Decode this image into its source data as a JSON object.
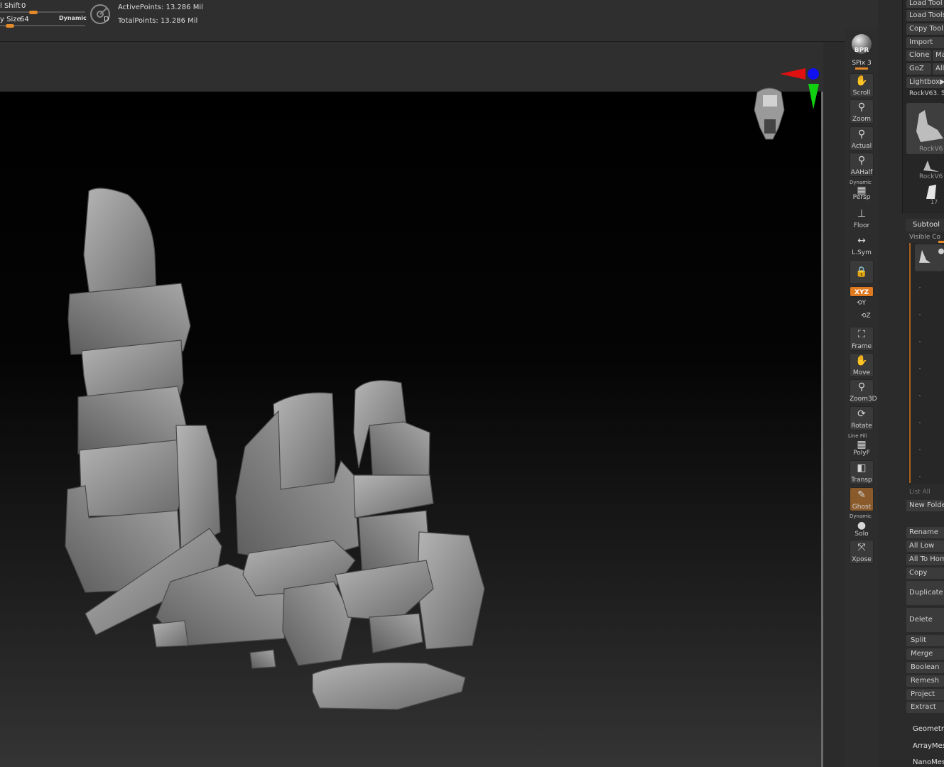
{
  "topbar": {
    "z_shift_label": "l Shift",
    "z_shift_value": "0",
    "z_shift_level": 0.4,
    "draw_size_label": "y Size",
    "draw_size_value": "64",
    "draw_size_level": 0.12,
    "dynamic_label": "Dynamic",
    "dial_label": "D",
    "active_points": "ActivePoints: 13.286 Mil",
    "total_points": "TotalPoints: 13.286 Mil"
  },
  "shelf": {
    "bpr_label": "BPR",
    "spix_label": "SPix 3",
    "items": [
      {
        "label": "Scroll",
        "icon": "hand-scroll-icon"
      },
      {
        "label": "Zoom",
        "icon": "zoom-icon"
      },
      {
        "label": "Actual",
        "icon": "actual-icon"
      },
      {
        "label": "AAHalf",
        "icon": "aahalf-icon"
      },
      {
        "label": "Persp",
        "icon": "perspective-icon",
        "top_note": "Dynamic"
      },
      {
        "label": "Floor",
        "icon": "floor-icon"
      },
      {
        "label": "L.Sym",
        "icon": "local-symmetry-icon"
      },
      {
        "label": "",
        "icon": "lock-icon"
      },
      {
        "label": "XYZ",
        "icon": "xyz-rotation-icon",
        "active": true
      },
      {
        "label": "Y",
        "icon": "y-rotation-icon"
      },
      {
        "label": "Z",
        "icon": "z-rotation-icon"
      },
      {
        "label": "Frame",
        "icon": "frame-icon"
      },
      {
        "label": "Move",
        "icon": "move-icon"
      },
      {
        "label": "Zoom3D",
        "icon": "zoom3d-icon"
      },
      {
        "label": "Rotate",
        "icon": "rotate-icon"
      },
      {
        "label": "PolyF",
        "icon": "polyframe-icon",
        "top_note": "Line Fill"
      },
      {
        "label": "Transp",
        "icon": "transparency-icon"
      },
      {
        "label": "Ghost",
        "icon": "ghost-icon",
        "active": true
      },
      {
        "label": "Solo",
        "icon": "solo-icon",
        "top_note": "Dynamic"
      },
      {
        "label": "Xpose",
        "icon": "xpose-icon"
      }
    ]
  },
  "tool_panel": {
    "buttons_top": [
      "Load Tool",
      "Load Tools",
      "Copy Tool",
      "Import"
    ],
    "clone": "Clone",
    "make": "Ma",
    "goz": "GoZ",
    "all": "All",
    "lightbox": "Lightbox▶",
    "current_tool": "RockV63. 5",
    "thumb_labels": [
      "RockV6",
      "RockV6",
      "17"
    ],
    "subtool_title": "Subtool",
    "visible_count": "Visible Co",
    "list_all": "List All",
    "new_folder": "New Folde",
    "rename": "Rename",
    "all_low": "All Low",
    "all_to_home": "All To Hom",
    "copy": "Copy",
    "duplicate": "Duplicate",
    "delete": "Delete",
    "split": "Split",
    "merge": "Merge",
    "boolean": "Boolean",
    "remesh": "Remesh",
    "project": "Project",
    "extract": "Extract",
    "geometry": "Geometry",
    "arraymesh": "ArrayMes",
    "nanomesh": "NanoMes"
  },
  "colors": {
    "accent": "#e58a2b",
    "axis_x": "#e01010",
    "axis_y": "#10d010",
    "axis_z": "#1010f0",
    "rock": "#8f8f8f"
  }
}
